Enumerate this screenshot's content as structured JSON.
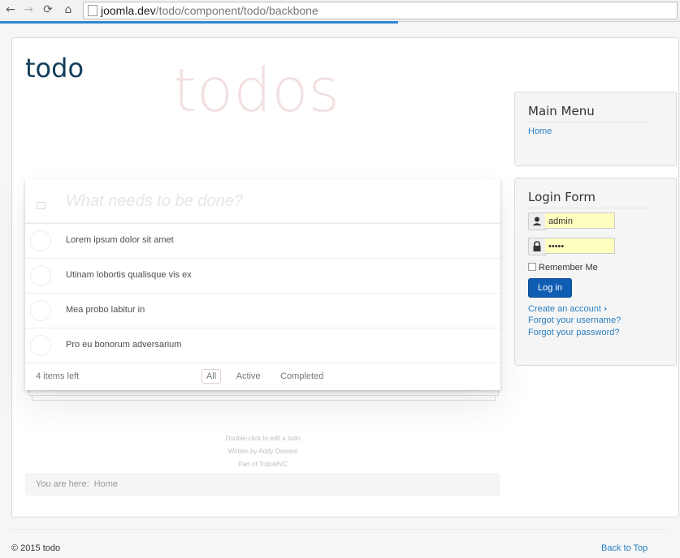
{
  "browser": {
    "url_host": "joomla.dev",
    "url_path": "/todo/component/todo/backbone"
  },
  "site": {
    "brand": "todo"
  },
  "todoapp": {
    "header": "todos",
    "new_placeholder": "What needs to be done?",
    "items": [
      {
        "title": "Lorem ipsum dolor sit amet",
        "completed": false
      },
      {
        "title": "Utinam lobortis qualisque vis ex",
        "completed": false
      },
      {
        "title": "Mea probo labitur in",
        "completed": false
      },
      {
        "title": "Pro eu bonorum adversarium",
        "completed": false
      }
    ],
    "count_text": "4 items left",
    "filters": [
      {
        "label": "All",
        "selected": true
      },
      {
        "label": "Active",
        "selected": false
      },
      {
        "label": "Completed",
        "selected": false
      }
    ],
    "info": [
      "Double-click to edit a todo",
      "Written by Addy Osmani",
      "Part of TodoMVC"
    ]
  },
  "breadcrumb": {
    "prefix": "You are here:",
    "home": "Home"
  },
  "main_menu": {
    "title": "Main Menu",
    "items": [
      "Home"
    ]
  },
  "login_form": {
    "title": "Login Form",
    "username_value": "admin",
    "password_value": "•••••",
    "remember_label": "Remember Me",
    "login_button": "Log in",
    "create_account": "Create an account",
    "forgot_username": "Forgot your username?",
    "forgot_password": "Forgot your password?"
  },
  "footer": {
    "copyright": "© 2015 todo",
    "back_to_top": "Back to Top"
  },
  "colors": {
    "link": "#2a7fbf",
    "brand": "#123e5a",
    "login_button": "#0f5cb3",
    "autofill": "#ffffc0"
  }
}
